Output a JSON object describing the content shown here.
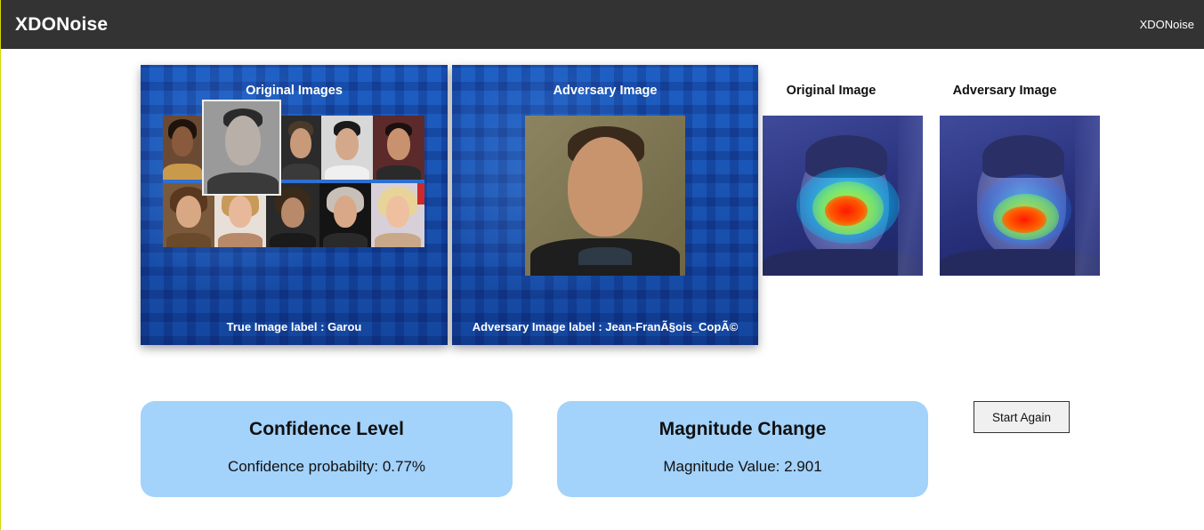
{
  "navbar": {
    "brand": "XDONoise",
    "right_link": "XDONoise"
  },
  "original_card": {
    "title": "Original Images",
    "footer": "True Image label : Garou"
  },
  "adversary_card": {
    "title": "Adversary Image",
    "footer": "Adversary Image label : Jean-FranÃ§ois_CopÃ©"
  },
  "heatmaps": {
    "original_title": "Original Image",
    "adversary_title": "Adversary Image"
  },
  "confidence": {
    "title": "Confidence Level",
    "value": "Confidence probabilty: 0.77%"
  },
  "magnitude": {
    "title": "Magnitude Change",
    "value": "Magnitude Value: 2.901"
  },
  "actions": {
    "start_again": "Start Again"
  },
  "colors": {
    "navbar_bg": "#333333",
    "card_blue": "#1b56b8",
    "info_box": "#a3d2fb"
  }
}
